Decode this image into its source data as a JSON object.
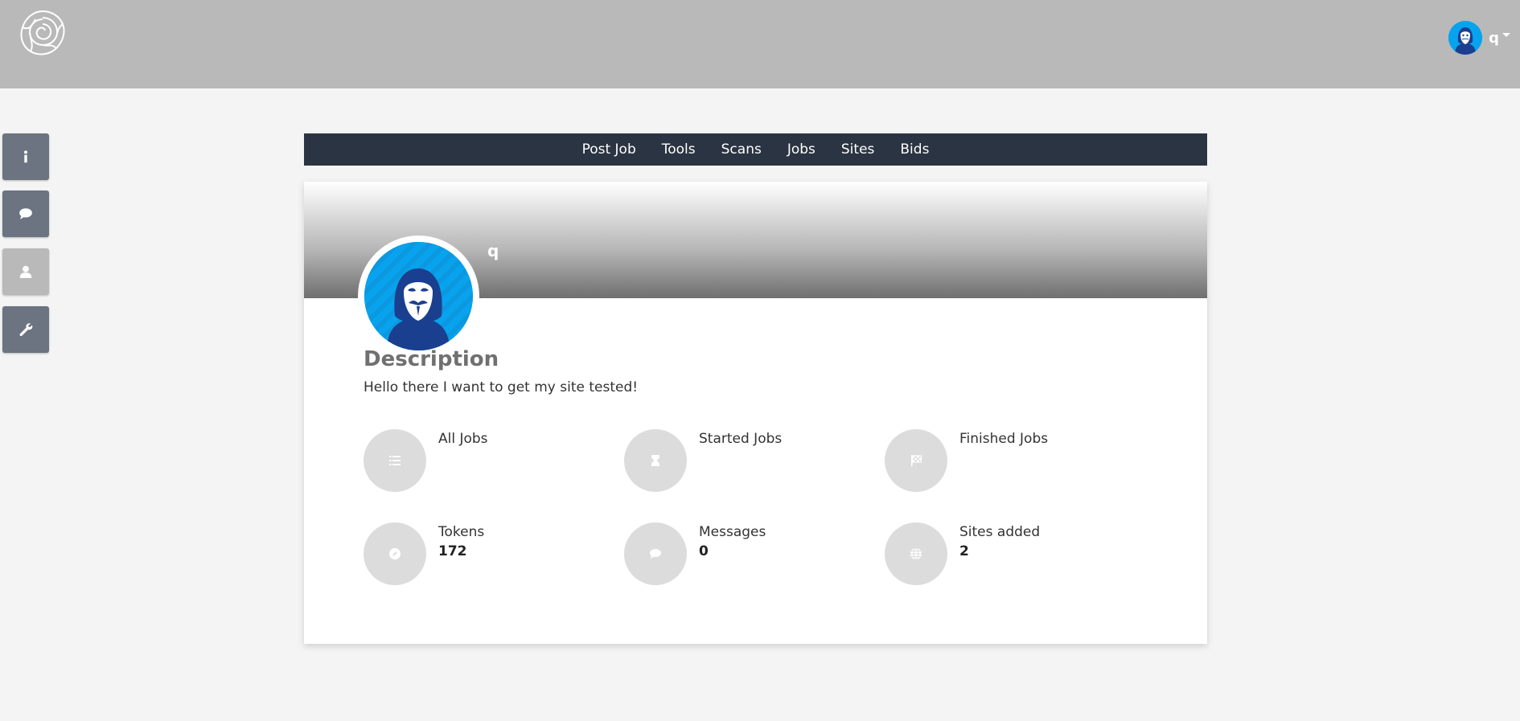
{
  "header": {
    "logo_icon": "rose-icon",
    "user": {
      "name": "q",
      "avatar_icon": "hacker-avatar-icon"
    }
  },
  "sidebar": {
    "buttons": [
      {
        "icon": "info-icon"
      },
      {
        "icon": "chat-icon"
      },
      {
        "icon": "user-icon",
        "active": true
      },
      {
        "icon": "wrench-icon"
      }
    ]
  },
  "nav": {
    "items": [
      "Post Job",
      "Tools",
      "Scans",
      "Jobs",
      "Sites",
      "Bids"
    ]
  },
  "profile": {
    "name": "q",
    "description_title": "Description",
    "description": "Hello there I want to get my site tested!"
  },
  "stats": [
    {
      "label": "All Jobs",
      "value": "",
      "icon": "list-icon"
    },
    {
      "label": "Started Jobs",
      "value": "",
      "icon": "hourglass-icon"
    },
    {
      "label": "Finished Jobs",
      "value": "",
      "icon": "checkered-flag-icon"
    },
    {
      "label": "Tokens",
      "value": "172",
      "icon": "compass-icon"
    },
    {
      "label": "Messages",
      "value": "0",
      "icon": "chat-icon"
    },
    {
      "label": "Sites added",
      "value": "2",
      "icon": "globe-icon"
    }
  ],
  "colors": {
    "header_bg": "#b8b9b8",
    "navbar_bg": "#2b3442",
    "avatar_blue": "#08a3ee",
    "side_button": "#6b7480"
  }
}
